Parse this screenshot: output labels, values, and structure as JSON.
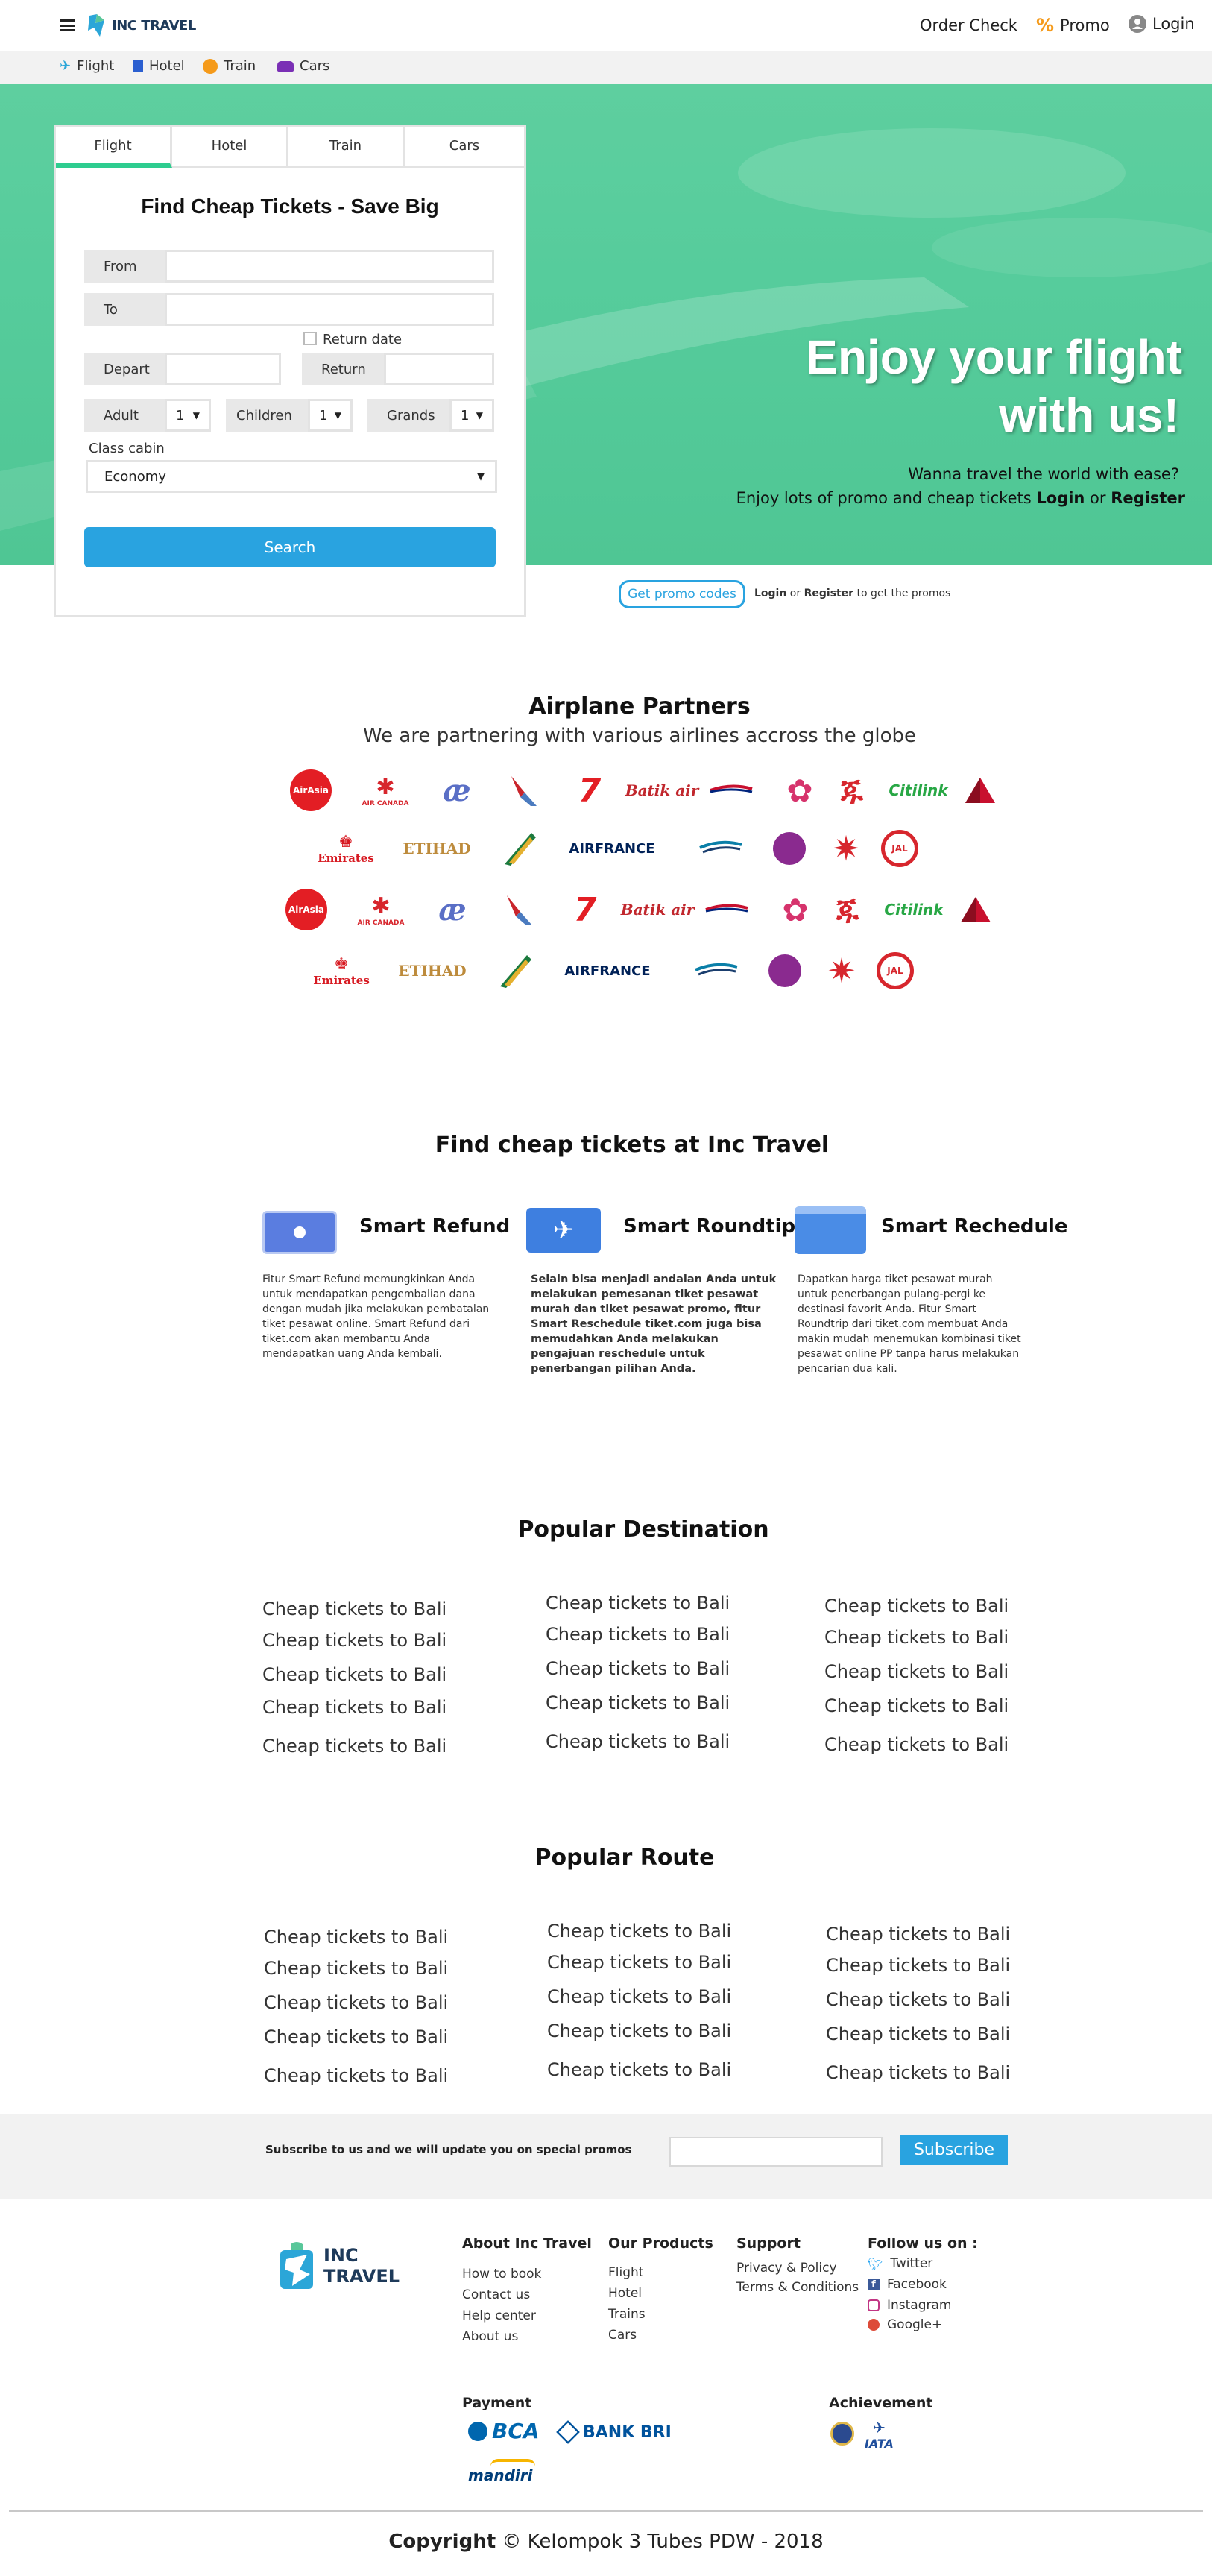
{
  "header": {
    "brand": "INC TRAVEL",
    "order_check": "Order Check",
    "promo": "Promo",
    "login": "Login"
  },
  "subnav": [
    "Flight",
    "Hotel",
    "Train",
    "Cars"
  ],
  "search": {
    "tabs": [
      "Flight",
      "Hotel",
      "Train",
      "Cars"
    ],
    "title": "Find Cheap Tickets - Save Big",
    "from_label": "From",
    "to_label": "To",
    "return_date_label": "Return date",
    "depart_label": "Depart",
    "return_label": "Return",
    "adult_label": "Adult",
    "adult_value": "1",
    "children_label": "Children",
    "children_value": "1",
    "grands_label": "Grands",
    "grands_value": "1",
    "class_label": "Class cabin",
    "class_value": "Economy",
    "search_button": "Search"
  },
  "hero": {
    "headline_1": "Enjoy your flight",
    "headline_2": "with us!",
    "line_1": "Wanna travel the world with ease?",
    "line_2_prefix": "Enjoy lots of promo and cheap tickets",
    "login": "Login",
    "or": "or",
    "register": "Register"
  },
  "promo": {
    "button": "Get promo codes",
    "login": "Login",
    "or": "or",
    "register": "Register",
    "suffix": "to get the promos"
  },
  "partners": {
    "title": "Airplane Partners",
    "subtitle": "We are partnering with various airlines accross the globe",
    "row_a": [
      "AirAsia",
      "AIR CANADA",
      "",
      "",
      "",
      "Batik air",
      "",
      "",
      "",
      "Citilink",
      ""
    ],
    "row_b": [
      "Emirates",
      "ETIHAD",
      "",
      "AIRFRANCE",
      "",
      "",
      "",
      "JAL"
    ]
  },
  "features": {
    "title": "Find cheap tickets at Inc Travel",
    "items": [
      {
        "title": "Smart Refund",
        "text": "Fitur Smart Refund memungkinkan Anda untuk mendapatkan pengembalian dana dengan mudah jika melakukan pembatalan tiket pesawat online. Smart Refund dari tiket.com akan membantu Anda mendapatkan uang Anda kembali."
      },
      {
        "title": "Smart Roundtip",
        "text": "Selain bisa menjadi andalan Anda untuk melakukan pemesanan tiket pesawat murah dan tiket pesawat promo, fitur Smart Reschedule tiket.com juga bisa memudahkan Anda melakukan pengajuan reschedule untuk penerbangan pilihan Anda."
      },
      {
        "title": "Smart Rechedule",
        "text": "Dapatkan harga tiket pesawat murah untuk penerbangan pulang-pergi ke destinasi favorit Anda. Fitur Smart Roundtrip dari tiket.com membuat Anda makin mudah menemukan kombinasi tiket pesawat online PP tanpa harus melakukan pencarian dua kali."
      }
    ]
  },
  "destinations": {
    "title": "Popular Destination",
    "item": "Cheap tickets to Bali"
  },
  "routes": {
    "title": "Popular Route",
    "item": "Cheap tickets to Bali"
  },
  "subscribe": {
    "text": "Subscribe to us and we will update you on special promos",
    "placeholder": "",
    "button": "Subscribe"
  },
  "footer": {
    "brand_1": "INC",
    "brand_2": "TRAVEL",
    "about_title": "About Inc Travel",
    "about": [
      "How to book",
      "Contact us",
      "Help center",
      "About us"
    ],
    "products_title": "Our Products",
    "products": [
      "Flight",
      "Hotel",
      "Trains",
      "Cars"
    ],
    "support_title": "Support",
    "support": [
      "Privacy & Policy",
      "Terms & Conditions"
    ],
    "follow_title": "Follow us on :",
    "social": [
      "Twitter",
      "Facebook",
      "Instagram",
      "Google+"
    ],
    "payment_title": "Payment",
    "payment": [
      "BCA",
      "BANK BRI",
      "mandiri"
    ],
    "achievement_title": "Achievement",
    "achievement": [
      "IATA"
    ],
    "copyright_prefix": "Copyright",
    "copyright": "© Kelompok 3 Tubes PDW - 2018"
  },
  "colors": {
    "accent": "#29a3e0",
    "hero": "#55cc9b",
    "promo_orange": "#f59a1a"
  }
}
